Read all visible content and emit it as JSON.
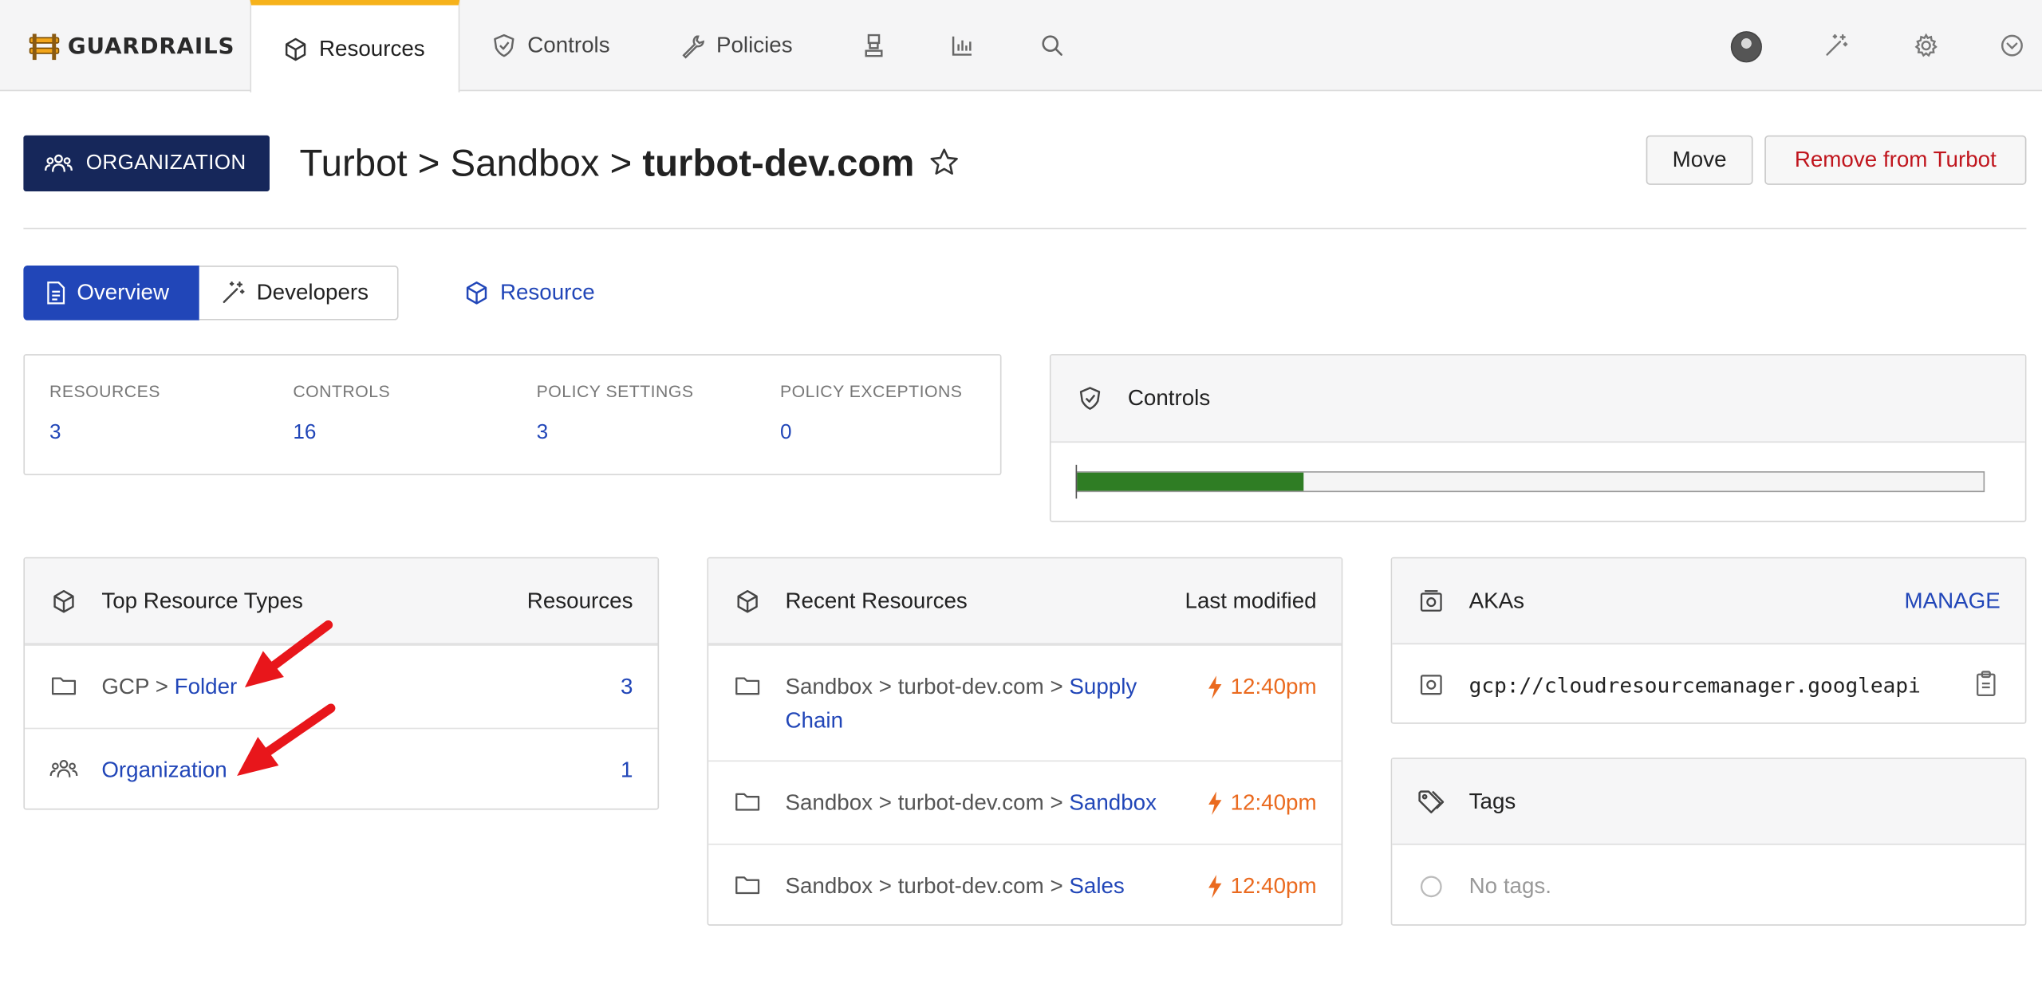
{
  "nav": {
    "brand": "GUARDRAILS",
    "tabs": [
      {
        "label": "Resources",
        "active": true
      },
      {
        "label": "Controls",
        "active": false
      },
      {
        "label": "Policies",
        "active": false
      }
    ],
    "icon_tabs": [
      "reports-icon",
      "chart-icon",
      "search-icon"
    ],
    "right_icons": [
      "avatar",
      "magic-wand-icon",
      "gear-icon",
      "chevron-down-circle-icon"
    ]
  },
  "header": {
    "badge": "ORGANIZATION",
    "breadcrumb": "Turbot > Sandbox >",
    "title": "turbot-dev.com",
    "move_label": "Move",
    "remove_label": "Remove from Turbot"
  },
  "subtabs": {
    "overview": "Overview",
    "developers": "Developers",
    "resource": "Resource"
  },
  "stats": [
    {
      "label": "RESOURCES",
      "value": "3"
    },
    {
      "label": "CONTROLS",
      "value": "16"
    },
    {
      "label": "POLICY SETTINGS",
      "value": "3"
    },
    {
      "label": "POLICY EXCEPTIONS",
      "value": "0"
    }
  ],
  "controls_card": {
    "title": "Controls",
    "ok_fraction": 0.25
  },
  "top_types": {
    "title": "Top Resource Types",
    "column": "Resources",
    "rows": [
      {
        "prefix": "GCP > ",
        "link": "Folder",
        "count": "3"
      },
      {
        "prefix": "",
        "link": "Organization",
        "count": "1"
      }
    ]
  },
  "recent": {
    "title": "Recent Resources",
    "column": "Last modified",
    "rows": [
      {
        "prefix": "Sandbox > turbot-dev.com > ",
        "link": "Supply Chain",
        "time": "12:40pm"
      },
      {
        "prefix": "Sandbox > turbot-dev.com > ",
        "link": "Sandbox",
        "time": "12:40pm"
      },
      {
        "prefix": "Sandbox > turbot-dev.com > ",
        "link": "Sales",
        "time": "12:40pm"
      }
    ]
  },
  "akas": {
    "title": "AKAs",
    "manage": "MANAGE",
    "value": "gcp://cloudresourcemanager.googleapi"
  },
  "tags": {
    "title": "Tags",
    "empty": "No tags."
  },
  "colors": {
    "brand_navy": "#16275a",
    "primary_blue": "#2146b8",
    "active_tab_accent": "#f6b21b",
    "danger": "#c0161e",
    "ok_green": "#2f7d24",
    "time_orange": "#ea6a1f",
    "annotation_arrow": "#e8161b"
  }
}
